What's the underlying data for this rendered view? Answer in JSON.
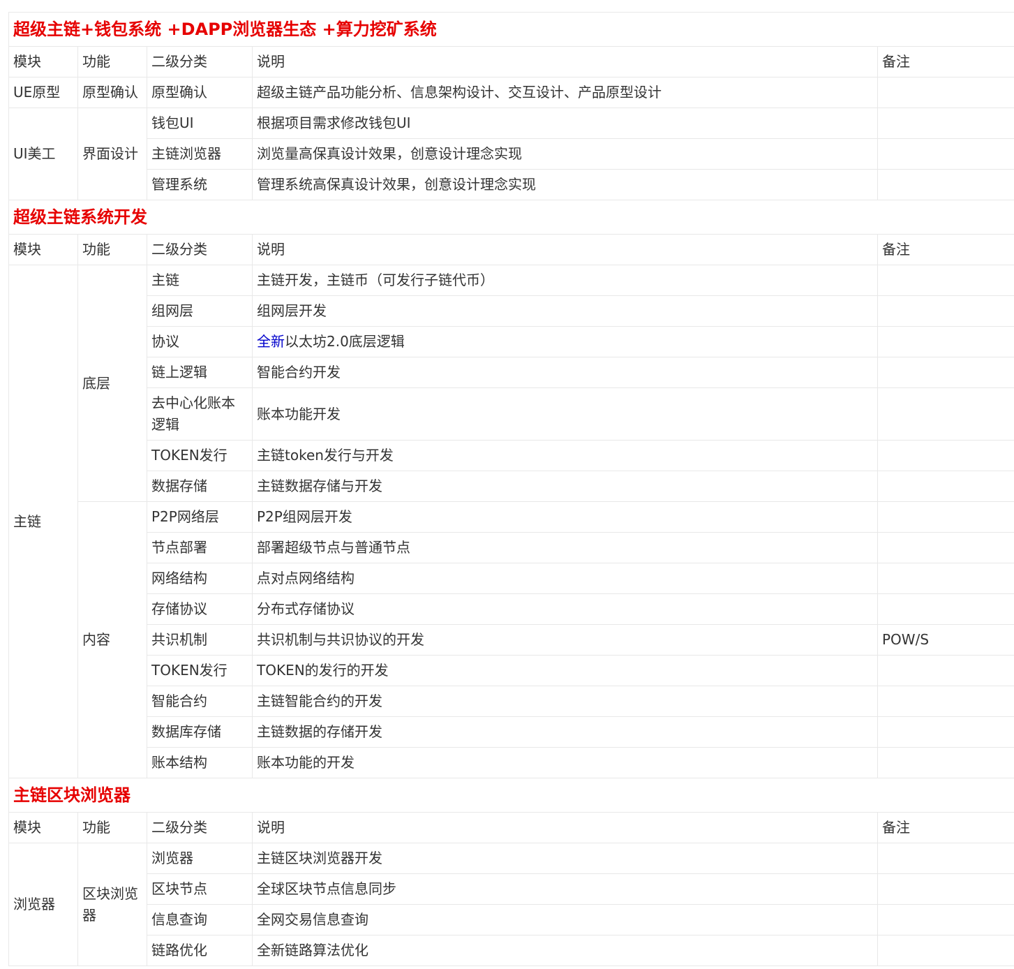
{
  "colors": {
    "section_title": "#e60000",
    "text": "#333333",
    "border": "#e8e8e8",
    "highlight": "#0000cc"
  },
  "sections": [
    {
      "title": "超级主链+钱包系统 +DAPP浏览器生态 +算力挖矿系统",
      "headers": [
        "模块",
        "功能",
        "二级分类",
        "说明",
        "备注"
      ],
      "module": "",
      "rows": [
        {
          "module": "UE原型",
          "function": "原型确认",
          "sub": "原型确认",
          "desc": "超级主链产品功能分析、信息架构设计、交互设计、产品原型设计",
          "note": ""
        },
        {
          "module": "UI美工",
          "function": "界面设计",
          "sub": "钱包UI",
          "desc": "根据项目需求修改钱包UI",
          "note": ""
        },
        {
          "sub": "主链浏览器",
          "desc": "浏览量高保真设计效果，创意设计理念实现",
          "note": ""
        },
        {
          "sub": "管理系统",
          "desc": "管理系统高保真设计效果，创意设计理念实现",
          "note": ""
        }
      ]
    },
    {
      "title": "超级主链系统开发",
      "headers": [
        "模块",
        "功能",
        "二级分类",
        "说明",
        "备注"
      ],
      "module": "主链",
      "groups": [
        {
          "function": "底层",
          "rows": [
            {
              "sub": "主链",
              "desc": "主链开发，主链币（可发行子链代币）",
              "note": ""
            },
            {
              "sub": "组网层",
              "desc": "组网层开发",
              "note": ""
            },
            {
              "sub": "协议",
              "desc_highlight": "全新",
              "desc": "以太坊2.0底层逻辑",
              "note": ""
            },
            {
              "sub": "链上逻辑",
              "desc": "智能合约开发",
              "note": ""
            },
            {
              "sub_line1": "去中心化账本",
              "sub_line2": "逻辑",
              "desc": "账本功能开发",
              "note": ""
            },
            {
              "sub": "TOKEN发行",
              "desc": "主链token发行与开发",
              "note": ""
            },
            {
              "sub": "数据存储",
              "desc": "主链数据存储与开发",
              "note": ""
            }
          ]
        },
        {
          "function": "内容",
          "rows": [
            {
              "sub": "P2P网络层",
              "desc": "P2P组网层开发",
              "note": ""
            },
            {
              "sub": "节点部署",
              "desc": "部署超级节点与普通节点",
              "note": ""
            },
            {
              "sub": "网络结构",
              "desc": "点对点网络结构",
              "note": ""
            },
            {
              "sub": "存储协议",
              "desc": "分布式存储协议",
              "note": ""
            },
            {
              "sub": "共识机制",
              "desc": "共识机制与共识协议的开发",
              "note": "POW/S"
            },
            {
              "sub": "TOKEN发行",
              "desc": "TOKEN的发行的开发",
              "note": ""
            },
            {
              "sub": "智能合约",
              "desc": "主链智能合约的开发",
              "note": ""
            },
            {
              "sub": "数据库存储",
              "desc": "主链数据的存储开发",
              "note": ""
            },
            {
              "sub": "账本结构",
              "desc": "账本功能的开发",
              "note": ""
            }
          ]
        }
      ]
    },
    {
      "title": "主链区块浏览器",
      "headers": [
        "模块",
        "功能",
        "二级分类",
        "说明",
        "备注"
      ],
      "module": "浏览器",
      "function_line1": "区块浏览",
      "function_line2": "器",
      "rows": [
        {
          "sub": "浏览器",
          "desc": "主链区块浏览器开发",
          "note": ""
        },
        {
          "sub": "区块节点",
          "desc": "全球区块节点信息同步",
          "note": ""
        },
        {
          "sub": "信息查询",
          "desc": "全网交易信息查询",
          "note": ""
        },
        {
          "sub": "链路优化",
          "desc": "全新链路算法优化",
          "note": ""
        }
      ]
    }
  ]
}
